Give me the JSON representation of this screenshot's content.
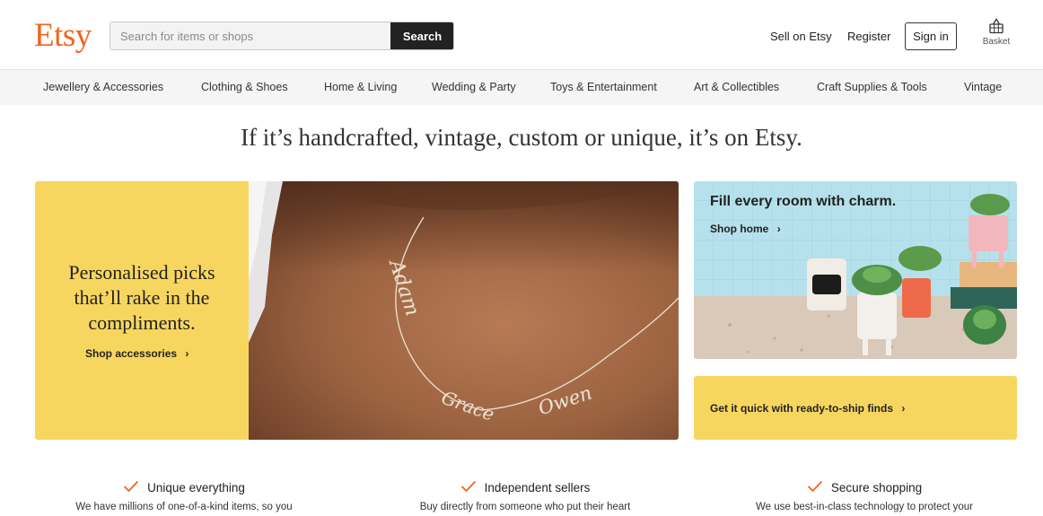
{
  "brand": {
    "logo": "Etsy",
    "accent_color": "#f1641e",
    "promo_yellow": "#f7d660"
  },
  "header": {
    "search": {
      "placeholder": "Search for items or shops",
      "value": "",
      "button_label": "Search"
    },
    "sell_label": "Sell on Etsy",
    "register_label": "Register",
    "signin_label": "Sign in",
    "basket_label": "Basket",
    "basket_icon": "basket-icon"
  },
  "nav": {
    "items": [
      {
        "label": "Jewellery & Accessories"
      },
      {
        "label": "Clothing & Shoes"
      },
      {
        "label": "Home & Living"
      },
      {
        "label": "Wedding & Party"
      },
      {
        "label": "Toys & Entertainment"
      },
      {
        "label": "Art & Collectibles"
      },
      {
        "label": "Craft Supplies & Tools"
      },
      {
        "label": "Vintage"
      }
    ]
  },
  "tagline": "If it’s handcrafted, vintage, custom or unique, it’s on Etsy.",
  "promos": {
    "accessories": {
      "title": "Personalised picks that’ll rake in the compliments.",
      "link": "Shop accessories",
      "image_names": [
        "Adam",
        "Grace",
        "Owen"
      ]
    },
    "home": {
      "title": "Fill every room with charm.",
      "link": "Shop home"
    },
    "ready": {
      "link": "Get it quick with ready-to-ship finds"
    },
    "chevron": "›"
  },
  "features": [
    {
      "title": "Unique everything",
      "text": "We have millions of one-of-a-kind items, so you",
      "icon": "check-icon"
    },
    {
      "title": "Independent sellers",
      "text": "Buy directly from someone who put their heart",
      "icon": "check-icon"
    },
    {
      "title": "Secure shopping",
      "text": "We use best-in-class technology to protect your",
      "icon": "check-icon"
    }
  ]
}
